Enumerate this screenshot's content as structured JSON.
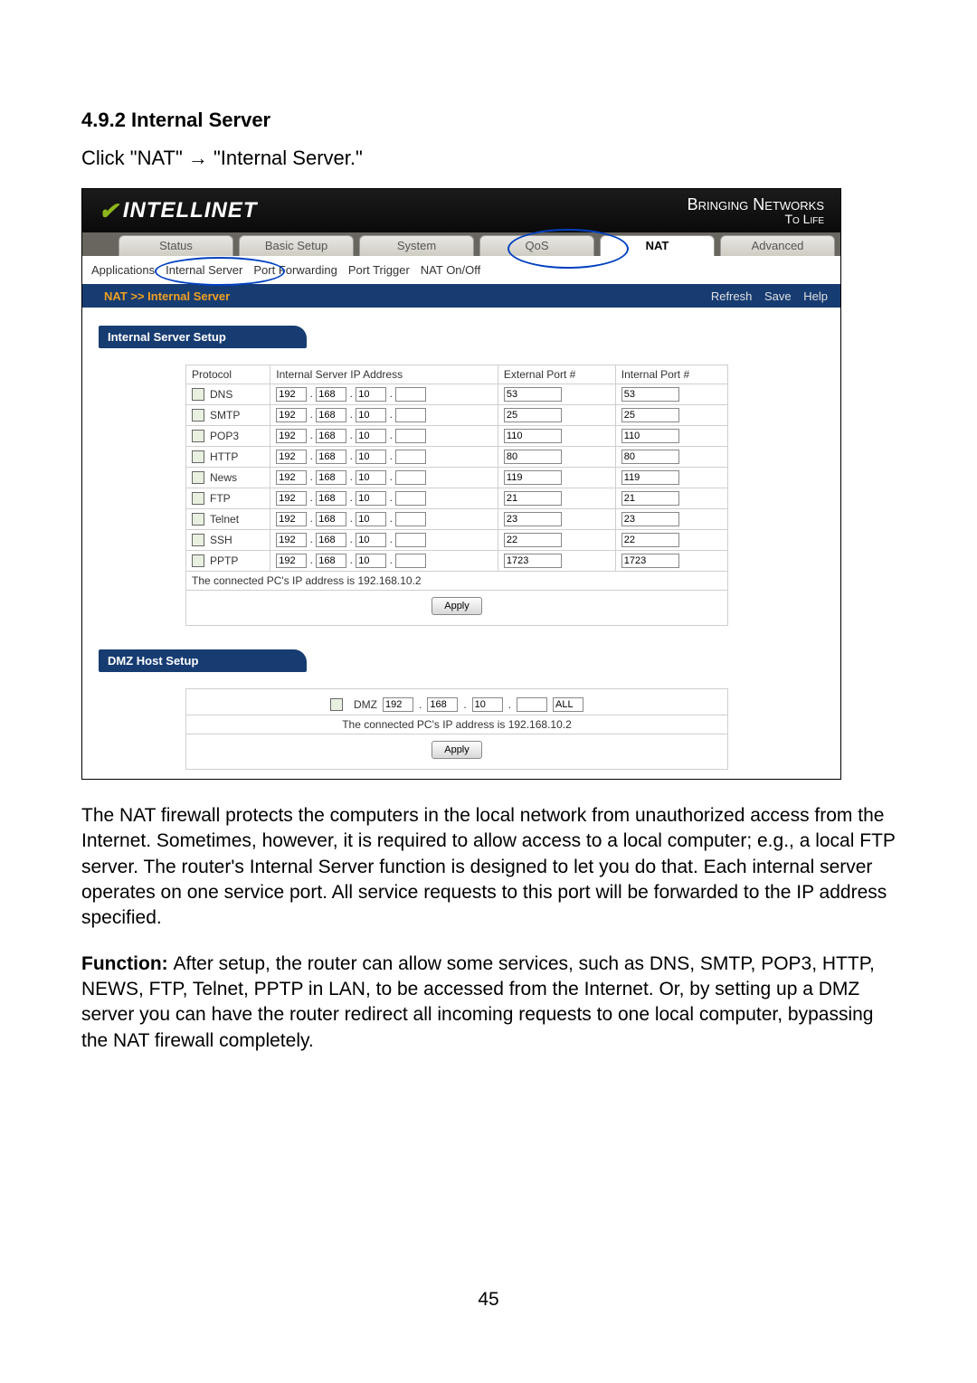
{
  "doc": {
    "heading": "4.9.2 Internal Server",
    "instruction": "Click \"NAT\" → \"Internal Server.\"",
    "page_number": "45",
    "para1": "The NAT firewall protects the computers in the local network from unauthorized access from the Internet. Sometimes, however, it is required to allow access to a local computer; e.g., a local FTP server. The router's Internal Server function is designed to let you do that. Each internal server operates on one service port. All service requests to this port will be forwarded to the IP address specified.",
    "para2_label": "Function: ",
    "para2": "After setup, the router can allow some services, such as DNS, SMTP, POP3, HTTP, NEWS, FTP, Telnet, PPTP in LAN, to be accessed from the Internet. Or, by setting up a DMZ server you can have the router redirect all incoming requests to one local computer, bypassing the NAT firewall completely."
  },
  "ui": {
    "brand": "INTELLINET",
    "tagline1": "Bringing Networks",
    "tagline2": "To Life",
    "main_tabs": [
      "Status",
      "Basic Setup",
      "System",
      "QoS",
      "NAT",
      "Advanced"
    ],
    "main_tab_active": "NAT",
    "sub_tabs": [
      "Applications",
      "Internal Server",
      "Port Forwarding",
      "Port Trigger",
      "NAT On/Off"
    ],
    "sub_tab_active": "Internal Server",
    "breadcrumb": "NAT >> Internal Server",
    "head_buttons": [
      "Refresh",
      "Save",
      "Help"
    ],
    "section1_title": "Internal Server Setup",
    "section2_title": "DMZ Host Setup",
    "table_headers": [
      "Protocol",
      "Internal Server IP Address",
      "External Port #",
      "Internal Port #"
    ],
    "rows": [
      {
        "proto": "DNS",
        "ip": [
          "192",
          "168",
          "10",
          ""
        ],
        "ext": "53",
        "int": "53"
      },
      {
        "proto": "SMTP",
        "ip": [
          "192",
          "168",
          "10",
          ""
        ],
        "ext": "25",
        "int": "25"
      },
      {
        "proto": "POP3",
        "ip": [
          "192",
          "168",
          "10",
          ""
        ],
        "ext": "110",
        "int": "110"
      },
      {
        "proto": "HTTP",
        "ip": [
          "192",
          "168",
          "10",
          ""
        ],
        "ext": "80",
        "int": "80"
      },
      {
        "proto": "News",
        "ip": [
          "192",
          "168",
          "10",
          ""
        ],
        "ext": "119",
        "int": "119"
      },
      {
        "proto": "FTP",
        "ip": [
          "192",
          "168",
          "10",
          ""
        ],
        "ext": "21",
        "int": "21"
      },
      {
        "proto": "Telnet",
        "ip": [
          "192",
          "168",
          "10",
          ""
        ],
        "ext": "23",
        "int": "23"
      },
      {
        "proto": "SSH",
        "ip": [
          "192",
          "168",
          "10",
          ""
        ],
        "ext": "22",
        "int": "22"
      },
      {
        "proto": "PPTP",
        "ip": [
          "192",
          "168",
          "10",
          ""
        ],
        "ext": "1723",
        "int": "1723"
      }
    ],
    "connected_pc": "The connected PC's IP address is 192.168.10.2",
    "apply": "Apply",
    "dmz": {
      "label": "DMZ",
      "ip": [
        "192",
        "168",
        "10",
        ""
      ],
      "all": "ALL"
    }
  }
}
